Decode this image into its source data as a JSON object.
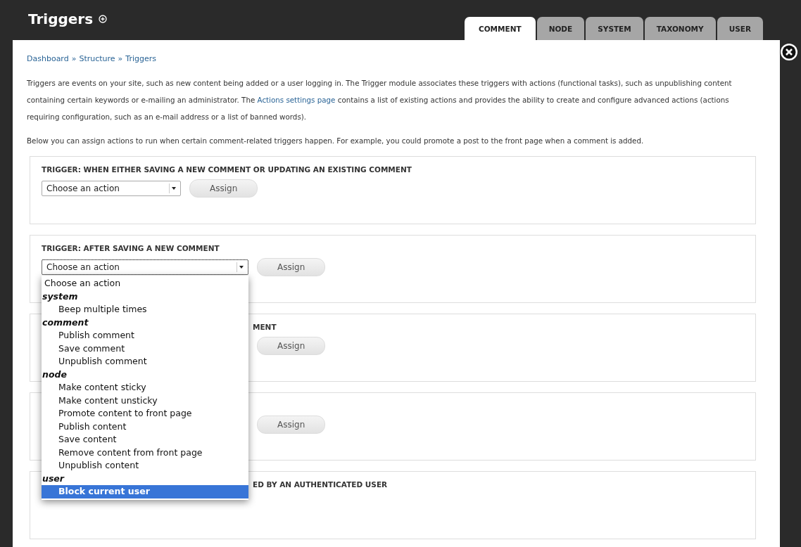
{
  "overlay": {
    "title": "Triggers"
  },
  "tabs": [
    {
      "label": "COMMENT",
      "selected": true
    },
    {
      "label": "NODE",
      "selected": false
    },
    {
      "label": "SYSTEM",
      "selected": false
    },
    {
      "label": "TAXONOMY",
      "selected": false
    },
    {
      "label": "USER",
      "selected": false
    }
  ],
  "breadcrumb": {
    "separator": "»",
    "items": [
      "Dashboard",
      "Structure",
      "Triggers"
    ]
  },
  "intro": {
    "before": "Triggers are events on your site, such as new content being added or a user logging in. The Trigger module associates these triggers with actions (functional tasks), such as unpublishing content containing certain keywords or e-mailing an administrator. The ",
    "link": "Actions settings page",
    "after": " contains a list of existing actions and provides the ability to create and configure advanced actions (actions requiring configuration, such as an e-mail address or a list of banned words)."
  },
  "note": "Below you can assign actions to run when certain comment-related triggers happen. For example, you could promote a post to the front page when a comment is added.",
  "fieldsets": [
    {
      "legend": "TRIGGER: WHEN EITHER SAVING A NEW COMMENT OR UPDATING AN EXISTING COMMENT",
      "covered": false,
      "select": {
        "value": "Choose an action",
        "focused": false,
        "open": false
      },
      "button": "Assign"
    },
    {
      "legend": "TRIGGER: AFTER SAVING A NEW COMMENT",
      "covered": false,
      "select": {
        "value": "Choose an action",
        "focused": true,
        "open": true
      },
      "button": "Assign"
    },
    {
      "legend": "MENT",
      "covered": true,
      "button": "Assign"
    },
    {
      "covered": true,
      "button": "Assign"
    },
    {
      "legend": "ED BY AN AUTHENTICATED USER",
      "covered": true
    }
  ],
  "dropdown": {
    "items": [
      {
        "kind": "option",
        "label": "Choose an action",
        "selected": false
      },
      {
        "kind": "group",
        "label": "system",
        "children": [
          {
            "label": "Beep multiple times",
            "selected": false
          }
        ]
      },
      {
        "kind": "group",
        "label": "comment",
        "children": [
          {
            "label": "Publish comment",
            "selected": false
          },
          {
            "label": "Save comment",
            "selected": false
          },
          {
            "label": "Unpublish comment",
            "selected": false
          }
        ]
      },
      {
        "kind": "group",
        "label": "node",
        "children": [
          {
            "label": "Make content sticky",
            "selected": false
          },
          {
            "label": "Make content unsticky",
            "selected": false
          },
          {
            "label": "Promote content to front page",
            "selected": false
          },
          {
            "label": "Publish content",
            "selected": false
          },
          {
            "label": "Save content",
            "selected": false
          },
          {
            "label": "Remove content from front page",
            "selected": false
          },
          {
            "label": "Unpublish content",
            "selected": false
          }
        ]
      },
      {
        "kind": "group",
        "label": "user",
        "children": [
          {
            "label": "Block current user",
            "selected": true
          }
        ]
      }
    ]
  }
}
